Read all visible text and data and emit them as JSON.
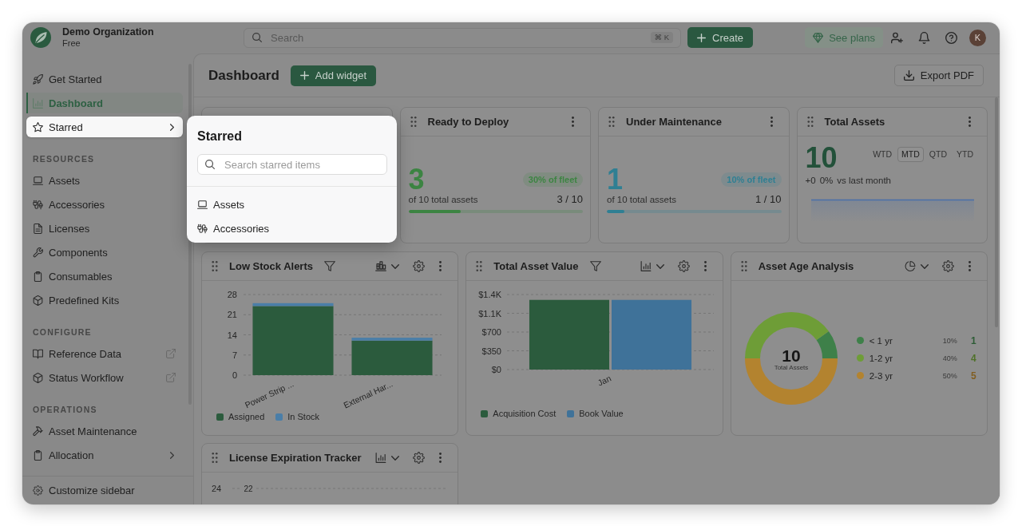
{
  "organization": {
    "name": "Demo Organization",
    "plan": "Free"
  },
  "search": {
    "placeholder": "Search",
    "shortcut": "⌘ K"
  },
  "header": {
    "create_label": "Create",
    "plans_label": "See plans",
    "avatar_initial": "K"
  },
  "sidebar": {
    "groups": [
      {
        "items": [
          {
            "label": "Get Started",
            "kind": "link",
            "selected": false,
            "expanded": false
          },
          {
            "label": "Dashboard",
            "kind": "link",
            "selected": true,
            "expanded": false
          },
          {
            "label": "Starred",
            "kind": "submenu",
            "selected": false,
            "expanded": true
          }
        ]
      },
      {
        "title": "RESOURCES",
        "items": [
          {
            "label": "Assets",
            "kind": "link",
            "selected": false,
            "expanded": false
          },
          {
            "label": "Accessories",
            "kind": "link",
            "selected": false,
            "expanded": false
          },
          {
            "label": "Licenses",
            "kind": "link",
            "selected": false,
            "expanded": false
          },
          {
            "label": "Components",
            "kind": "link",
            "selected": false,
            "expanded": false
          },
          {
            "label": "Consumables",
            "kind": "link",
            "selected": false,
            "expanded": false
          },
          {
            "label": "Predefined Kits",
            "kind": "link",
            "selected": false,
            "expanded": false
          }
        ]
      },
      {
        "title": "CONFIGURE",
        "items": [
          {
            "label": "Reference Data",
            "kind": "external",
            "selected": false,
            "expanded": false
          },
          {
            "label": "Status Workflow",
            "kind": "external",
            "selected": false,
            "expanded": false
          }
        ]
      },
      {
        "title": "OPERATIONS",
        "items": [
          {
            "label": "Asset Maintenance",
            "kind": "link",
            "selected": false,
            "expanded": false
          },
          {
            "label": "Allocation",
            "kind": "submenu",
            "selected": false,
            "expanded": false
          }
        ]
      }
    ],
    "footer_label": "Customize sidebar"
  },
  "starred_popover": {
    "title": "Starred",
    "search_placeholder": "Search starred items",
    "items": [
      {
        "label": "Assets"
      },
      {
        "label": "Accessories"
      }
    ]
  },
  "page": {
    "title": "Dashboard",
    "add_widget_label": "Add widget",
    "export_label": "Export PDF"
  },
  "kpi_cards": [
    {
      "kind": "ratio",
      "title": "Ready to Deploy",
      "value": "3",
      "badge": "30% of fleet",
      "caption": "of 10 total assets",
      "ratio": "3 / 10",
      "level": 0.3,
      "color": "#3c8442"
    },
    {
      "kind": "ratio",
      "title": "Under Maintenance",
      "value": "1",
      "badge": "10% of fleet",
      "caption": "of 10 total assets",
      "ratio": "1 / 10",
      "level": 0.1,
      "color": "#2f7f93"
    },
    {
      "kind": "trend",
      "title": "Total Assets",
      "value": "10",
      "periods": [
        {
          "label": "WTD",
          "selected": false
        },
        {
          "label": "MTD",
          "selected": true
        },
        {
          "label": "QTD",
          "selected": false
        },
        {
          "label": "YTD",
          "selected": false
        }
      ],
      "change": "+0",
      "change_percent": "0%",
      "comparison": "vs last month"
    }
  ],
  "widgets": [
    {
      "kind": "stacked_bar",
      "title": "Low Stock Alerts",
      "filterable": true,
      "chart_data": {
        "type": "bar",
        "stacked": true,
        "grid": true,
        "categories": [
          "Power Strip ...",
          "External Har..."
        ],
        "series": [
          {
            "name": "Assigned",
            "color": "#2b5b3d",
            "values": [
              24,
              12
            ]
          },
          {
            "name": "In Stock",
            "color": "#4a7ea8",
            "values": [
              1,
              1
            ]
          }
        ],
        "ylim": [
          0,
          28
        ],
        "yticks": [
          0,
          7,
          14,
          21,
          28
        ]
      }
    },
    {
      "kind": "bar",
      "title": "Total Asset Value",
      "filterable": true,
      "chart_data": {
        "type": "bar",
        "stacked": false,
        "grid": true,
        "categories": [
          "Jan"
        ],
        "series": [
          {
            "name": "Acquisition Cost",
            "color": "#2b5b3d",
            "values": [
              1300
            ]
          },
          {
            "name": "Book Value",
            "color": "#3f7299",
            "values": [
              1300
            ]
          }
        ],
        "ylim": [
          0,
          1400
        ],
        "yticks": [
          {
            "value": 0,
            "label": "$0"
          },
          {
            "value": 350,
            "label": "$350"
          },
          {
            "value": 700,
            "label": "$700"
          },
          {
            "value": 1050,
            "label": "$1.1K"
          },
          {
            "value": 1400,
            "label": "$1.4K"
          }
        ]
      }
    },
    {
      "kind": "donut",
      "title": "Asset Age Analysis",
      "filterable": false,
      "center_value": "10",
      "center_label": "Total Assets",
      "legend": [
        {
          "color": "#3e8049",
          "percent": "10%",
          "count": "1"
        },
        {
          "color": "#6e9d37",
          "percent": "40%",
          "count": "4"
        },
        {
          "color": "#b3832f",
          "percent": "50%",
          "count": "5"
        }
      ],
      "chart_data": {
        "type": "donut",
        "categories": [
          "< 1 yr",
          "1-2 yr",
          "2-3 yr"
        ],
        "values": [
          1,
          4,
          5
        ]
      }
    },
    {
      "kind": "tracker",
      "title": "License Expiration Tracker",
      "filterable": false,
      "y_tick": "24",
      "value_label": "22"
    }
  ]
}
